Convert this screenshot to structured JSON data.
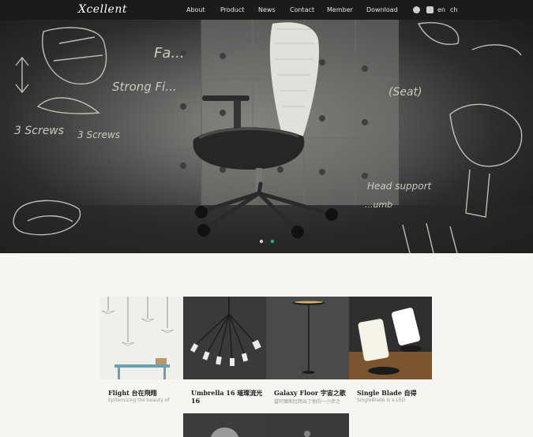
{
  "header": {
    "logo": "Xcellent",
    "nav": [
      "About",
      "Product",
      "News",
      "Contact",
      "Member",
      "Download"
    ],
    "lang": [
      "en",
      "ch"
    ]
  },
  "hero": {
    "sketch_notes": [
      "Fa...",
      "Strong Fi...",
      "3 Screws",
      "3 Screws",
      "(Seat)",
      "Head support",
      "...umb"
    ],
    "slides": 2,
    "active_slide": 0
  },
  "products": [
    {
      "title": "Flight 台在飛翔",
      "desc": "Epitomizing the beauty of"
    },
    {
      "title": "Umbrella 16 璀璨流光 16",
      "desc": ""
    },
    {
      "title": "Galaxy Floor 宇宙之歌",
      "desc": "當阿爾斯壯跨出了他的一小步之"
    },
    {
      "title": "Single Blade 自得",
      "desc": "SingleBlade is a LED"
    }
  ],
  "colors": {
    "header": "#1b1b1b",
    "background": "#f6f5f1",
    "accent_dot": "#2fa88a"
  }
}
